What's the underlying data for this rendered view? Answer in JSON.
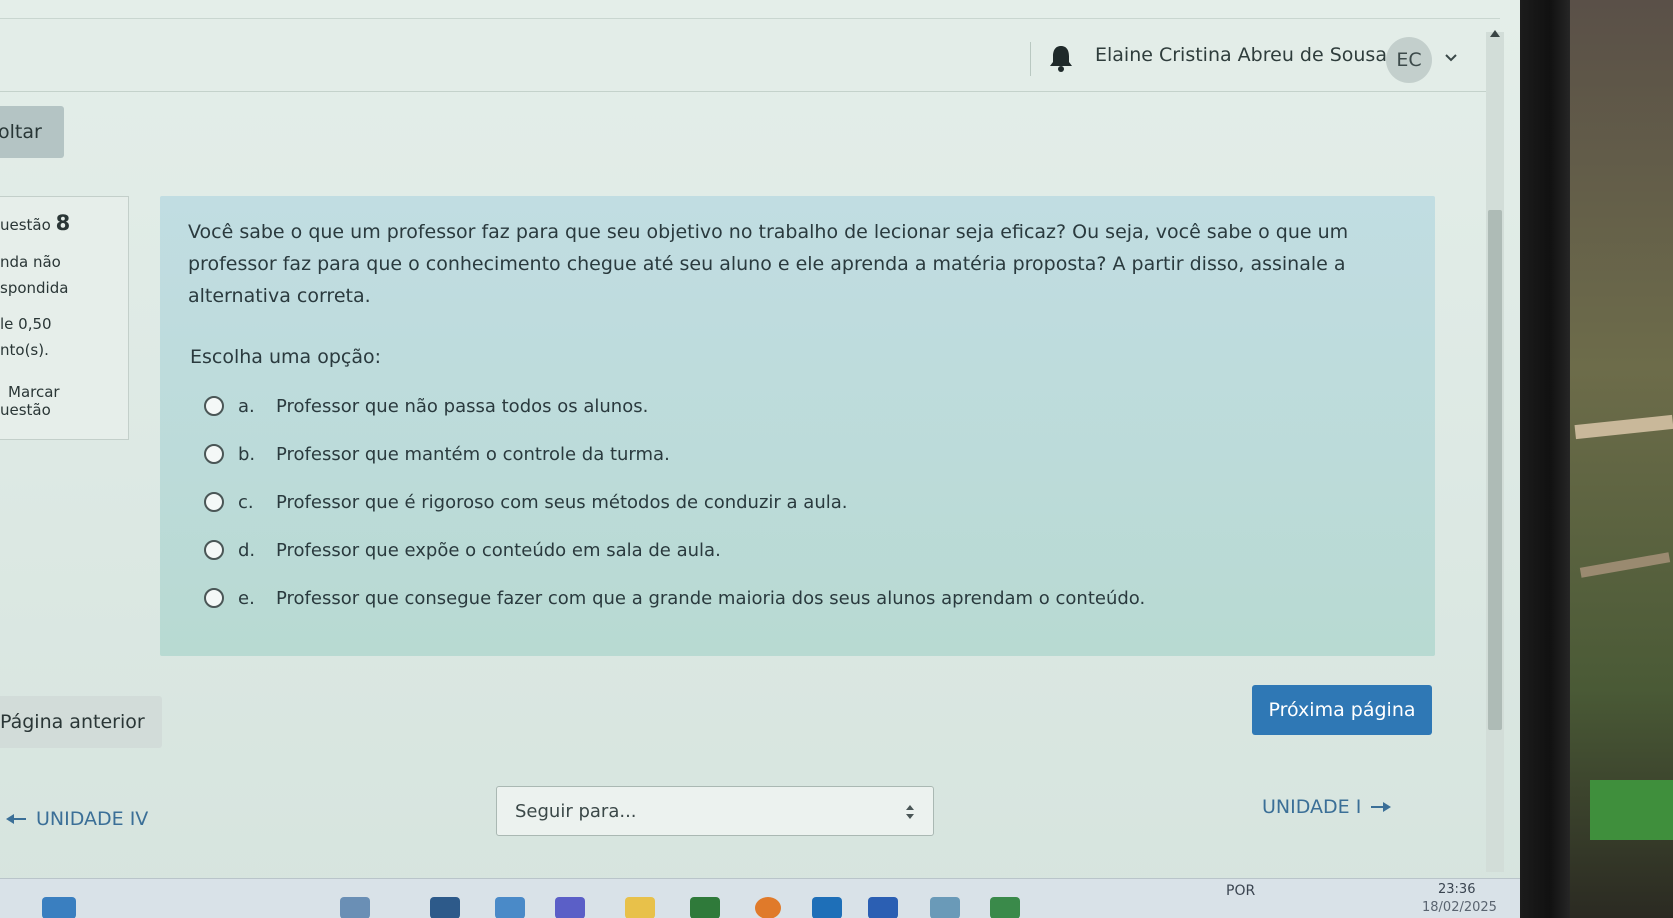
{
  "header": {
    "user_name": "Elaine Cristina Abreu de Sousa",
    "avatar_initials": "EC"
  },
  "back_button": {
    "label": "oltar"
  },
  "question_info": {
    "number_prefix": "uestão",
    "number": "8",
    "status_line1": "nda não",
    "status_line2": "spondida",
    "grade_line1": "le 0,50",
    "grade_line2": "nto(s).",
    "flag_line1": "Marcar",
    "flag_line2": "uestão"
  },
  "question": {
    "text": "Você sabe o que um professor faz para que seu objetivo no trabalho de lecionar seja eficaz? Ou seja, você sabe o que um professor faz para que o conhecimento chegue até seu aluno e ele aprenda a matéria proposta? A partir disso, assinale a alternativa correta.",
    "prompt": "Escolha uma opção:",
    "options": [
      {
        "letter": "a.",
        "text": "Professor que não passa todos os alunos."
      },
      {
        "letter": "b.",
        "text": "Professor que mantém o controle da turma."
      },
      {
        "letter": "c.",
        "text": "Professor que é rigoroso com seus métodos de conduzir a aula."
      },
      {
        "letter": "d.",
        "text": "Professor que expõe o conteúdo em sala de aula."
      },
      {
        "letter": "e.",
        "text": "Professor que consegue fazer com que a grande maioria dos seus alunos aprendam o conteúdo."
      }
    ]
  },
  "navigation": {
    "prev_page": "Página anterior",
    "next_page": "Próxima página",
    "prev_activity": "UNIDADE IV",
    "jump_placeholder": "Seguir para...",
    "next_activity": "UNIDADE I"
  },
  "taskbar": {
    "language": "POR",
    "time": "23:36",
    "date": "18/02/2025"
  },
  "colors": {
    "primary_button": "#2f78b5",
    "question_bg": "#bcdbd9",
    "link": "#3b6f97"
  }
}
